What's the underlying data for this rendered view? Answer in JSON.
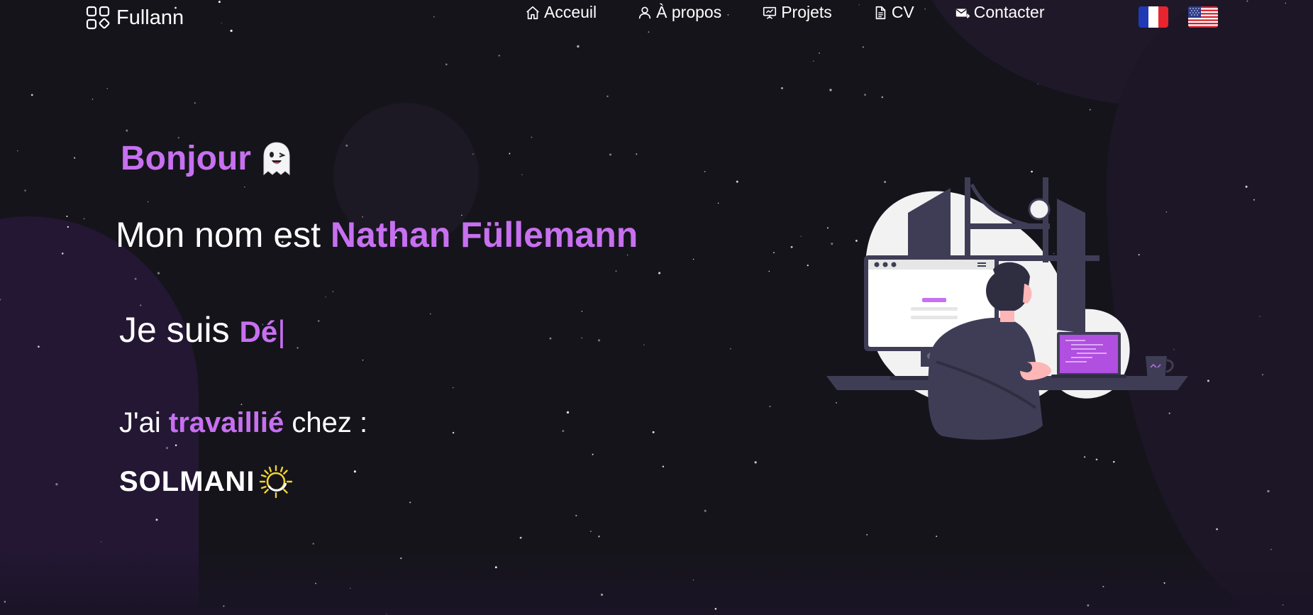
{
  "navbar": {
    "brand": "Fullann",
    "links": [
      {
        "label": "Acceuil",
        "icon": "home-icon"
      },
      {
        "label": "À propos",
        "icon": "user-icon"
      },
      {
        "label": "Projets",
        "icon": "presentation-icon"
      },
      {
        "label": "CV",
        "icon": "document-icon"
      },
      {
        "label": "Contacter",
        "icon": "mail-icon"
      }
    ],
    "languages": [
      {
        "code": "fr",
        "icon": "french-flag-icon"
      },
      {
        "code": "en",
        "icon": "us-flag-icon"
      }
    ]
  },
  "hero": {
    "greeting": "Bonjour",
    "greeting_emoji": "ghost-icon",
    "name_prefix": "Mon nom est ",
    "name": "Nathan Füllemann",
    "role_prefix": "Je suis ",
    "role_typed": "Dé",
    "typing_cursor": "|",
    "worked_prefix": "J'ai ",
    "worked_highlight": "travaillié",
    "worked_suffix": " chez :",
    "company": "SOLMANI",
    "company_icon": "sun-icon"
  },
  "colors": {
    "accent": "#c770f0",
    "background": "#15141b",
    "text": "#ffffff"
  }
}
